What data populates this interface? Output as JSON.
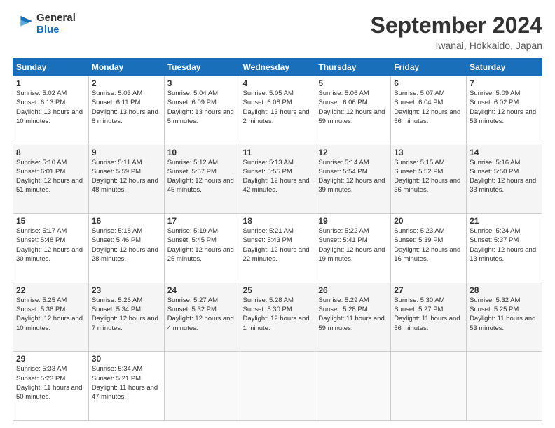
{
  "header": {
    "logo_line1": "General",
    "logo_line2": "Blue",
    "month_title": "September 2024",
    "location": "Iwanai, Hokkaido, Japan"
  },
  "days_of_week": [
    "Sunday",
    "Monday",
    "Tuesday",
    "Wednesday",
    "Thursday",
    "Friday",
    "Saturday"
  ],
  "weeks": [
    [
      {
        "day": "1",
        "sunrise": "5:02 AM",
        "sunset": "6:13 PM",
        "daylight": "13 hours and 10 minutes."
      },
      {
        "day": "2",
        "sunrise": "5:03 AM",
        "sunset": "6:11 PM",
        "daylight": "13 hours and 8 minutes."
      },
      {
        "day": "3",
        "sunrise": "5:04 AM",
        "sunset": "6:09 PM",
        "daylight": "13 hours and 5 minutes."
      },
      {
        "day": "4",
        "sunrise": "5:05 AM",
        "sunset": "6:08 PM",
        "daylight": "13 hours and 2 minutes."
      },
      {
        "day": "5",
        "sunrise": "5:06 AM",
        "sunset": "6:06 PM",
        "daylight": "12 hours and 59 minutes."
      },
      {
        "day": "6",
        "sunrise": "5:07 AM",
        "sunset": "6:04 PM",
        "daylight": "12 hours and 56 minutes."
      },
      {
        "day": "7",
        "sunrise": "5:09 AM",
        "sunset": "6:02 PM",
        "daylight": "12 hours and 53 minutes."
      }
    ],
    [
      {
        "day": "8",
        "sunrise": "5:10 AM",
        "sunset": "6:01 PM",
        "daylight": "12 hours and 51 minutes."
      },
      {
        "day": "9",
        "sunrise": "5:11 AM",
        "sunset": "5:59 PM",
        "daylight": "12 hours and 48 minutes."
      },
      {
        "day": "10",
        "sunrise": "5:12 AM",
        "sunset": "5:57 PM",
        "daylight": "12 hours and 45 minutes."
      },
      {
        "day": "11",
        "sunrise": "5:13 AM",
        "sunset": "5:55 PM",
        "daylight": "12 hours and 42 minutes."
      },
      {
        "day": "12",
        "sunrise": "5:14 AM",
        "sunset": "5:54 PM",
        "daylight": "12 hours and 39 minutes."
      },
      {
        "day": "13",
        "sunrise": "5:15 AM",
        "sunset": "5:52 PM",
        "daylight": "12 hours and 36 minutes."
      },
      {
        "day": "14",
        "sunrise": "5:16 AM",
        "sunset": "5:50 PM",
        "daylight": "12 hours and 33 minutes."
      }
    ],
    [
      {
        "day": "15",
        "sunrise": "5:17 AM",
        "sunset": "5:48 PM",
        "daylight": "12 hours and 30 minutes."
      },
      {
        "day": "16",
        "sunrise": "5:18 AM",
        "sunset": "5:46 PM",
        "daylight": "12 hours and 28 minutes."
      },
      {
        "day": "17",
        "sunrise": "5:19 AM",
        "sunset": "5:45 PM",
        "daylight": "12 hours and 25 minutes."
      },
      {
        "day": "18",
        "sunrise": "5:21 AM",
        "sunset": "5:43 PM",
        "daylight": "12 hours and 22 minutes."
      },
      {
        "day": "19",
        "sunrise": "5:22 AM",
        "sunset": "5:41 PM",
        "daylight": "12 hours and 19 minutes."
      },
      {
        "day": "20",
        "sunrise": "5:23 AM",
        "sunset": "5:39 PM",
        "daylight": "12 hours and 16 minutes."
      },
      {
        "day": "21",
        "sunrise": "5:24 AM",
        "sunset": "5:37 PM",
        "daylight": "12 hours and 13 minutes."
      }
    ],
    [
      {
        "day": "22",
        "sunrise": "5:25 AM",
        "sunset": "5:36 PM",
        "daylight": "12 hours and 10 minutes."
      },
      {
        "day": "23",
        "sunrise": "5:26 AM",
        "sunset": "5:34 PM",
        "daylight": "12 hours and 7 minutes."
      },
      {
        "day": "24",
        "sunrise": "5:27 AM",
        "sunset": "5:32 PM",
        "daylight": "12 hours and 4 minutes."
      },
      {
        "day": "25",
        "sunrise": "5:28 AM",
        "sunset": "5:30 PM",
        "daylight": "12 hours and 1 minute."
      },
      {
        "day": "26",
        "sunrise": "5:29 AM",
        "sunset": "5:28 PM",
        "daylight": "11 hours and 59 minutes."
      },
      {
        "day": "27",
        "sunrise": "5:30 AM",
        "sunset": "5:27 PM",
        "daylight": "11 hours and 56 minutes."
      },
      {
        "day": "28",
        "sunrise": "5:32 AM",
        "sunset": "5:25 PM",
        "daylight": "11 hours and 53 minutes."
      }
    ],
    [
      {
        "day": "29",
        "sunrise": "5:33 AM",
        "sunset": "5:23 PM",
        "daylight": "11 hours and 50 minutes."
      },
      {
        "day": "30",
        "sunrise": "5:34 AM",
        "sunset": "5:21 PM",
        "daylight": "11 hours and 47 minutes."
      },
      null,
      null,
      null,
      null,
      null
    ]
  ]
}
